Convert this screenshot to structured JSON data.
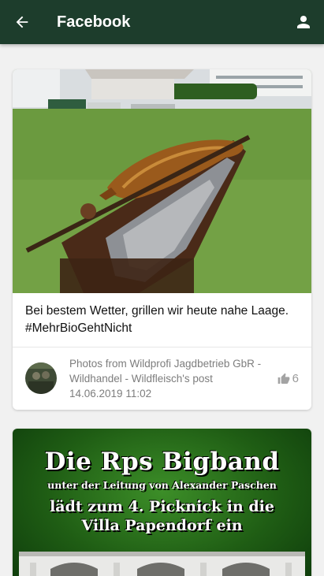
{
  "appbar": {
    "title": "Facebook",
    "back_icon": "arrow-back-icon",
    "profile_icon": "person-icon",
    "background": "#1d3d2c"
  },
  "posts": [
    {
      "text": "Bei bestem Wetter, grillen wir heute nahe Laage. #MehrBioGehtNicht",
      "source": "Photos from Wildprofi Jagdbetrieb GbR - Wildhandel - Wildfleisch's post",
      "date": "14.06.2019 11:02",
      "likes": "6",
      "like_icon": "thumbs-up-icon"
    },
    {
      "poster_lines": [
        "Die Rps Bigband",
        "unter der Leitung von Alexander Paschen",
        "lädt zum 4. Picknick in die",
        "Villa Papendorf ein"
      ]
    }
  ]
}
